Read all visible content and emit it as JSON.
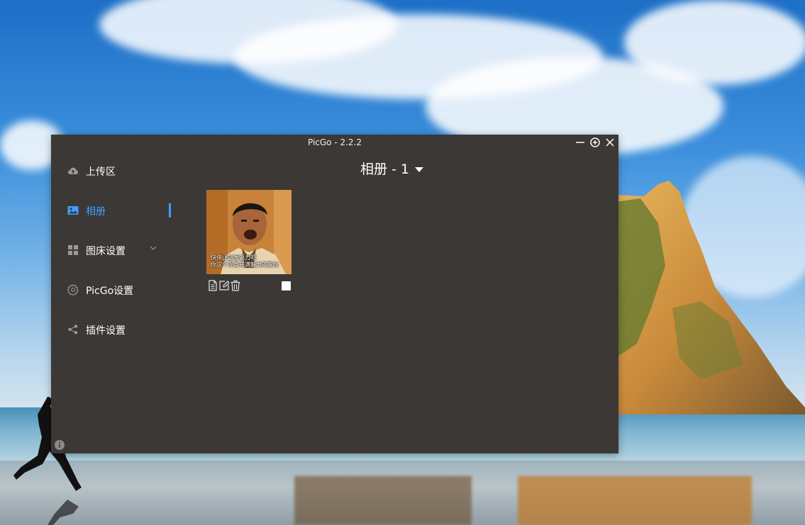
{
  "window": {
    "title": "PicGo - 2.2.2"
  },
  "sidebar": {
    "items": [
      {
        "label": "上传区",
        "icon": "cloud-upload-icon"
      },
      {
        "label": "相册",
        "icon": "image-icon",
        "active": true
      },
      {
        "label": "图床设置",
        "icon": "grid-icon",
        "has_dropdown": true
      },
      {
        "label": "PicGo设置",
        "icon": "gear-icon"
      },
      {
        "label": "插件设置",
        "icon": "share-icon"
      }
    ]
  },
  "album": {
    "title": "相册 - 1",
    "photos": [
      {
        "caption_line1": "快停止散发魅力吧",
        "caption_line2": "你这个浑身充满魅力的家伙",
        "selected": false
      }
    ]
  },
  "colors": {
    "window_bg": "#3b3835",
    "accent": "#409eff",
    "text": "#ffffff"
  }
}
